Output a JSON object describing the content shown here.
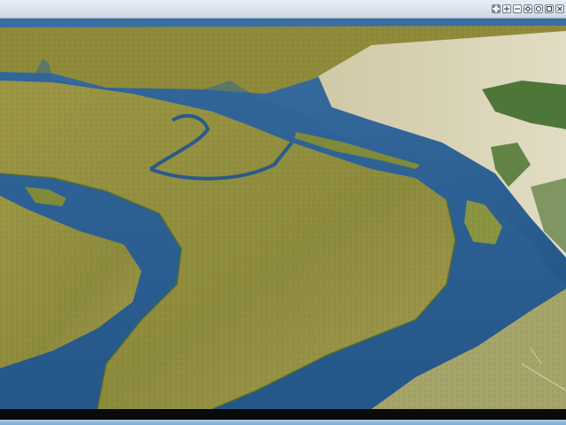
{
  "window": {
    "title": "",
    "toolbar": [
      {
        "name": "fullscreen-icon",
        "symbol": "expand"
      },
      {
        "name": "zoom-in-icon",
        "symbol": "plus"
      },
      {
        "name": "zoom-out-icon",
        "symbol": "minus"
      },
      {
        "name": "settings-icon",
        "symbol": "gear"
      },
      {
        "name": "refresh-icon",
        "symbol": "circle"
      },
      {
        "name": "window-icon",
        "symbol": "square"
      },
      {
        "name": "close-icon",
        "symbol": "x"
      }
    ]
  },
  "viewport": {
    "scene": "aerial-terrain-view",
    "colors": {
      "water": "#2c5f93",
      "water_deep": "#1c4b7c",
      "marsh": "#8f8a3a",
      "marsh_light": "#a9a04f",
      "sand": "#d8d2b5",
      "forest": "#3f6a2a"
    }
  }
}
